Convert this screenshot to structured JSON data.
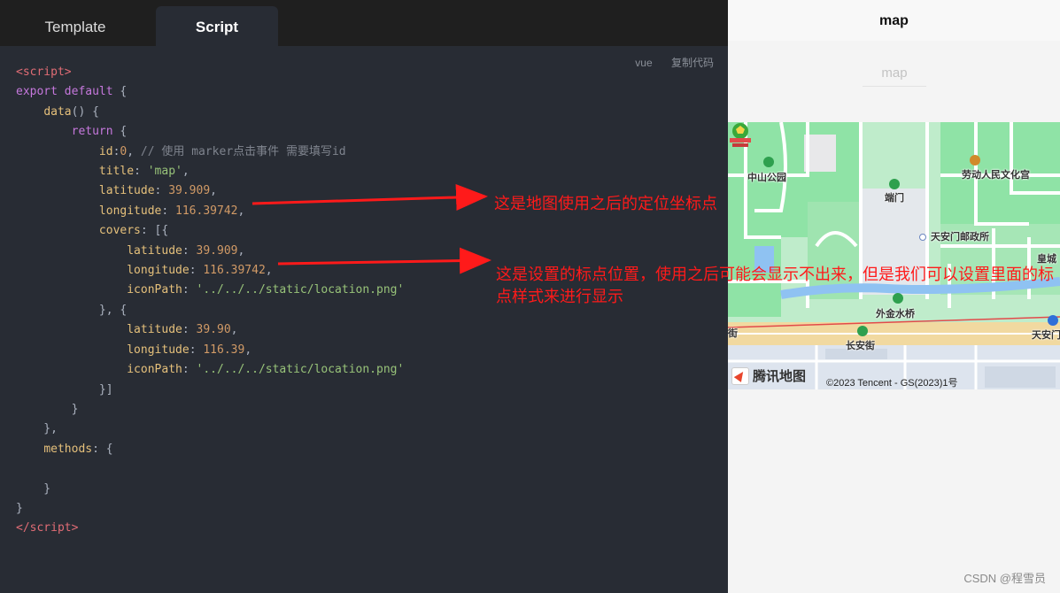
{
  "tabs": [
    {
      "label": "Template",
      "active": false
    },
    {
      "label": "Script",
      "active": true
    }
  ],
  "code_meta": {
    "language": "vue",
    "copy_label": "复制代码"
  },
  "code": {
    "open_tag": "script",
    "export": "export default",
    "data_fn": "data",
    "return_kw": "return",
    "id_key": "id",
    "id_value": "0",
    "id_comment": "// 使用 marker点击事件 需要填写id",
    "title_key": "title",
    "title_value": "'map'",
    "latitude_key": "latitude",
    "latitude_value": "39.909",
    "longitude_key": "longitude",
    "longitude_value": "116.39742",
    "covers_key": "covers",
    "covers": [
      {
        "latitude": "39.909",
        "longitude": "116.39742",
        "iconPath": "'../../../static/location.png'"
      },
      {
        "latitude": "39.90",
        "longitude": "116.39",
        "iconPath": "'../../../static/location.png'"
      }
    ],
    "icon_key": "iconPath",
    "methods_key": "methods",
    "close_tag": "script"
  },
  "annotations": {
    "location_note": "这是地图使用之后的定位坐标点",
    "marker_note": "这是设置的标点位置，使用之后可能会显示不出来，但是我们可以设置里面的标点样式来进行显示",
    "color": "#ff1a1a"
  },
  "preview": {
    "nav_title": "map",
    "page_heading": "map",
    "map": {
      "labels": [
        {
          "text": "中山公园"
        },
        {
          "text": "端门"
        },
        {
          "text": "劳动人民文化宫"
        },
        {
          "text": "天安门邮政所"
        },
        {
          "text": "皇城"
        },
        {
          "text": "外金水桥"
        },
        {
          "text": "长安街"
        },
        {
          "text": "天安门"
        },
        {
          "text": "街"
        }
      ],
      "provider": "腾讯地图",
      "copyright": "©2023 Tencent - GS(2023)1号"
    }
  },
  "watermark": "CSDN @程雪员",
  "colors": {
    "editor_bg": "#282c34",
    "tabbar_bg": "#1f1f1f",
    "map_green": "#8fe3a6"
  }
}
